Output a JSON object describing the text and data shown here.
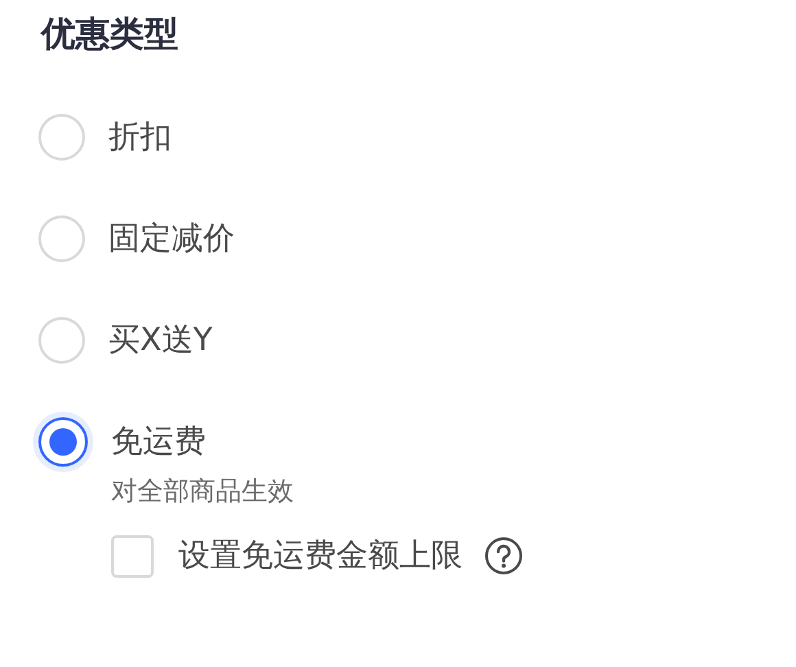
{
  "title": "优惠类型",
  "options": [
    {
      "label": "折扣",
      "selected": false
    },
    {
      "label": "固定减价",
      "selected": false
    },
    {
      "label": "买X送Y",
      "selected": false
    },
    {
      "label": "免运费",
      "selected": true,
      "description": "对全部商品生效",
      "checkbox": {
        "label": "设置免运费金额上限",
        "checked": false
      }
    }
  ]
}
